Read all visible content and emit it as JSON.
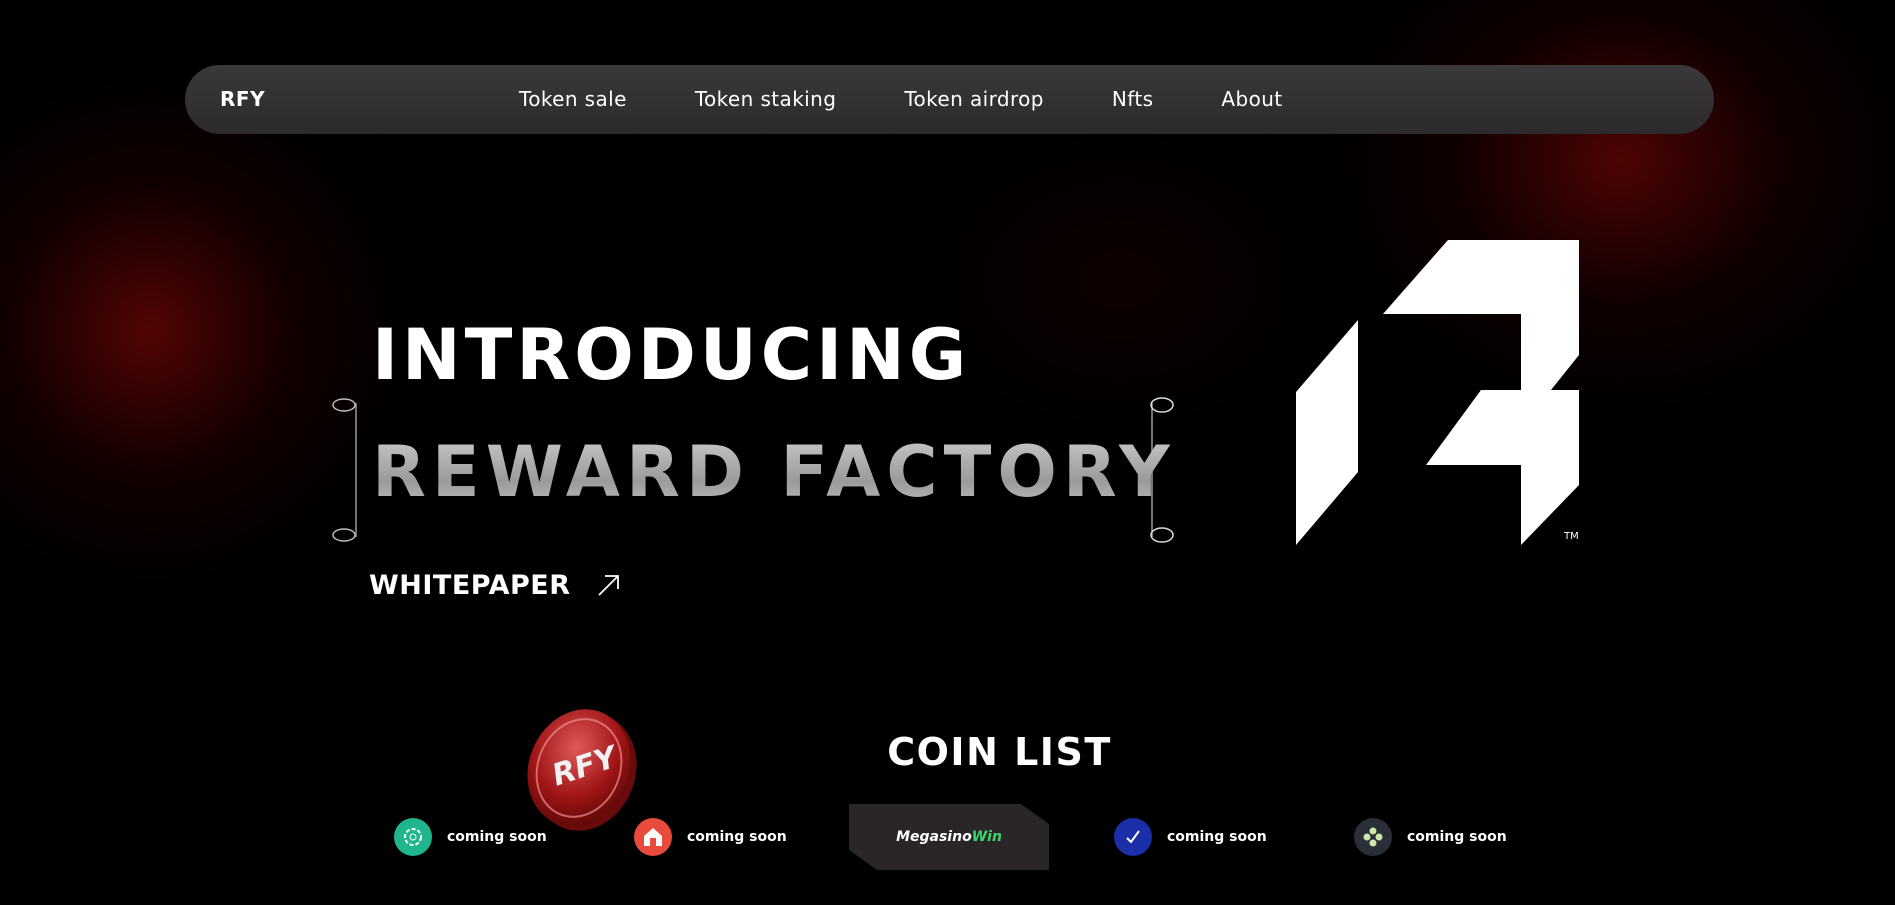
{
  "nav": {
    "brand": "RFY",
    "links": [
      "Token sale",
      "Token staking",
      "Token airdrop",
      "Nfts",
      "About"
    ]
  },
  "hero": {
    "intro": "INTRODUCING",
    "title": "REWARD FACTORY",
    "whitepaper_label": "WHITEPAPER",
    "logo_trademark": "TM"
  },
  "coin": {
    "emblem_text": "RFY"
  },
  "coin_list": {
    "title": "COIN LIST",
    "items": [
      {
        "label": "coming soon",
        "icon": "teal-ring-icon",
        "color": "#1fb58f"
      },
      {
        "label": "coming soon",
        "icon": "red-house-icon",
        "color": "#e84a3b"
      },
      {
        "label": "coming soon",
        "icon": "check-icon",
        "color": "#1a2fa8"
      },
      {
        "label": "coming soon",
        "icon": "clover-icon",
        "color": "#2a2e38"
      }
    ],
    "partner": {
      "name_part1": "Megasino",
      "name_part2": "Win"
    }
  },
  "colors": {
    "background": "#000000",
    "nav_bg": "#353333",
    "accent_red": "#6e0606",
    "partner_accent": "#38d66b"
  }
}
